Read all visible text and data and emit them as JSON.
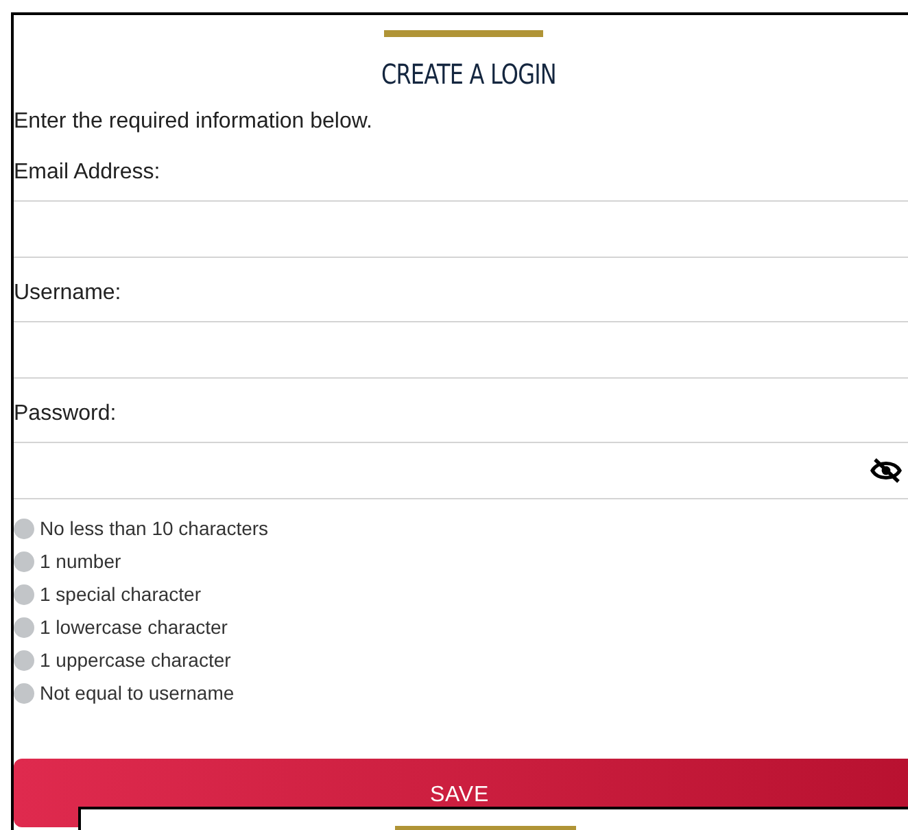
{
  "title": "CREATE A LOGIN",
  "intro": "Enter the required information below.",
  "fields": [
    {
      "label": "Email Address:",
      "kind": "text"
    },
    {
      "label": "Username:",
      "kind": "text"
    },
    {
      "label": "Password:",
      "kind": "password"
    }
  ],
  "requirements": [
    {
      "text": "No less than 10 characters",
      "met": false
    },
    {
      "text": "1 number",
      "met": false
    },
    {
      "text": "1 special character",
      "met": false
    },
    {
      "text": "1 lowercase character",
      "met": false
    },
    {
      "text": "1 uppercase character",
      "met": false
    },
    {
      "text": "Not equal to username",
      "met": false
    }
  ],
  "save_button": "SAVE"
}
